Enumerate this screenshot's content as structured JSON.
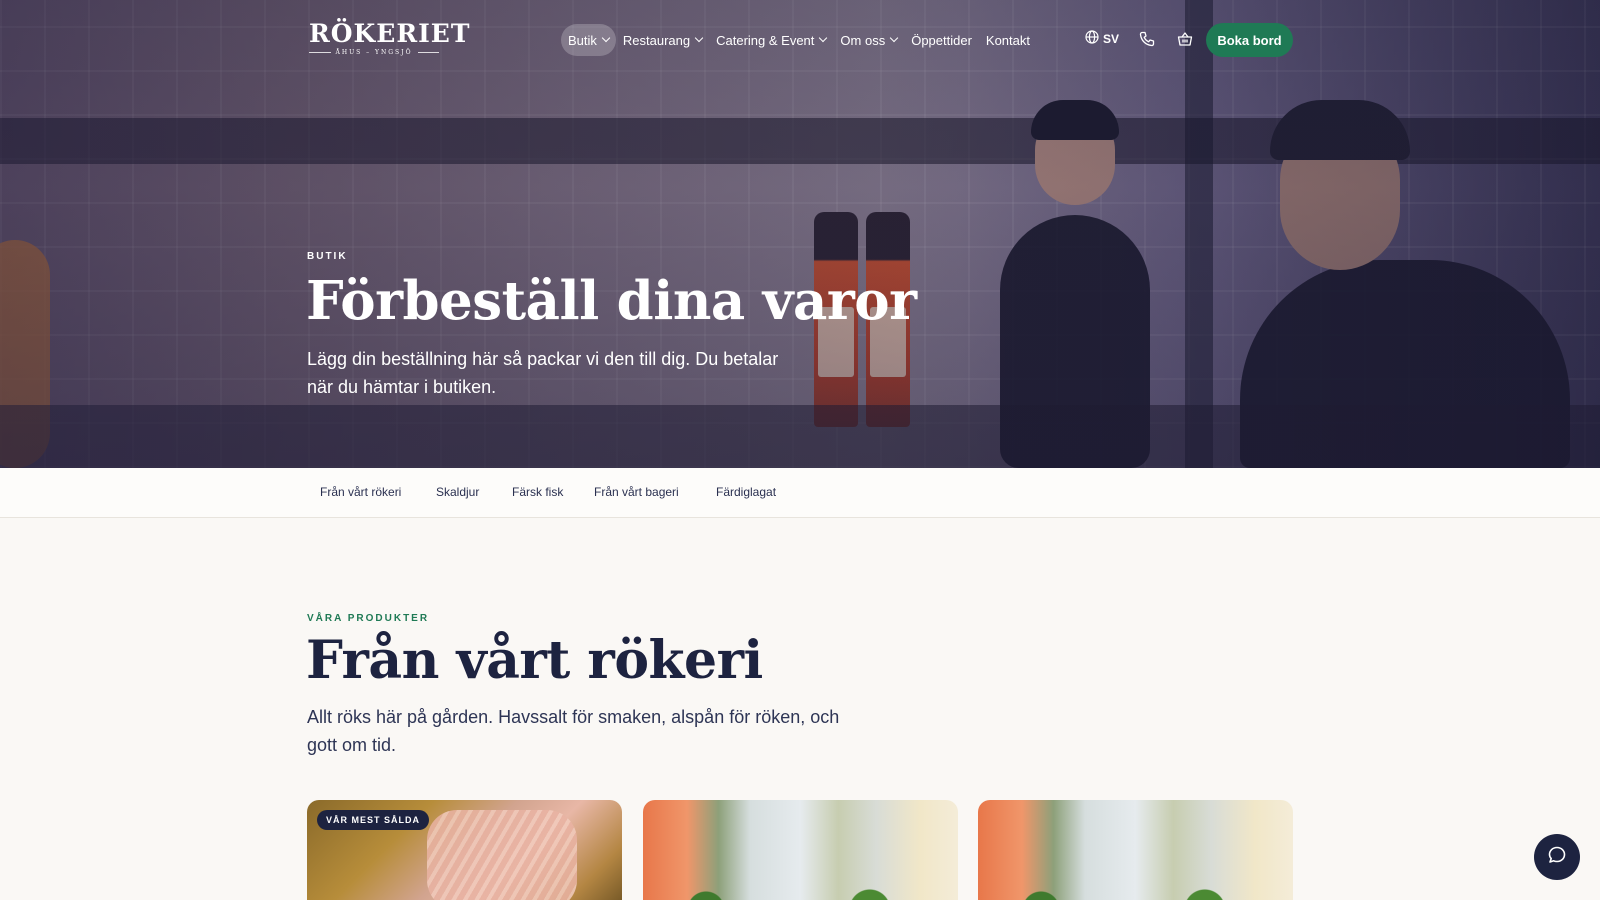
{
  "brand": {
    "name": "RÖKERIET",
    "tagline": "ÅHUS – YNGSJÖ"
  },
  "nav": {
    "items": [
      {
        "label": "Butik"
      },
      {
        "label": "Restaurang"
      },
      {
        "label": "Catering & Event"
      },
      {
        "label": "Om oss"
      },
      {
        "label": "Öppettider"
      },
      {
        "label": "Kontakt"
      }
    ],
    "language": "SV",
    "book_label": "Boka bord"
  },
  "hero": {
    "eyebrow": "BUTIK",
    "title": "Förbeställ dina varor",
    "text": "Lägg din beställning här så packar vi den till dig. Du betalar när du hämtar i butiken."
  },
  "categories": [
    "Från vårt rökeri",
    "Skaldjur",
    "Färsk fisk",
    "Från vårt bageri",
    "Färdiglagat"
  ],
  "section": {
    "eyebrow": "VÅRA PRODUKTER",
    "title": "Från vårt rökeri",
    "text": "Allt röks här på gården. Havssalt för smaken, alspån för röken, och gott om tid."
  },
  "products": [
    {
      "badge": "VÅR MEST SÅLDA"
    },
    {
      "badge": ""
    },
    {
      "badge": ""
    }
  ],
  "colors": {
    "accent": "#1f7a55",
    "navy": "#1d2340",
    "background": "#faf8f5"
  }
}
